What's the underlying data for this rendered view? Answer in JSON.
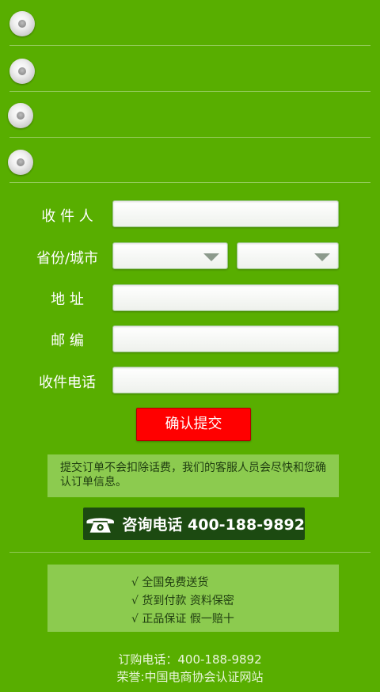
{
  "form": {
    "recipient_label": "收 件 人",
    "province_city_label": "省份/城市",
    "address_label": "地 址",
    "postcode_label": "邮 编",
    "phone_label": "收件电话",
    "recipient_value": "",
    "address_value": "",
    "postcode_value": "",
    "phone_value": "",
    "province_selected": "",
    "city_selected": "",
    "submit_label": "确认提交"
  },
  "notice": "提交订单不会扣除话费，我们的客服人员会尽快和您确认订单信息。",
  "hotline": {
    "label": "咨询电话 400-188-9892",
    "icon": "telephone-icon"
  },
  "features": [
    "√  全国免费送货",
    "√  货到付款 资料保密",
    "√  正品保证 假一赔十"
  ],
  "footer": {
    "order_phone": "订购电话：400-188-9892",
    "honor": "荣誉:中国电商协会认证网站"
  },
  "colors": {
    "background": "#58ae00",
    "submit": "#ff0000",
    "panel": "#8ccb4f",
    "hotline_bg": "#1c4a11"
  }
}
